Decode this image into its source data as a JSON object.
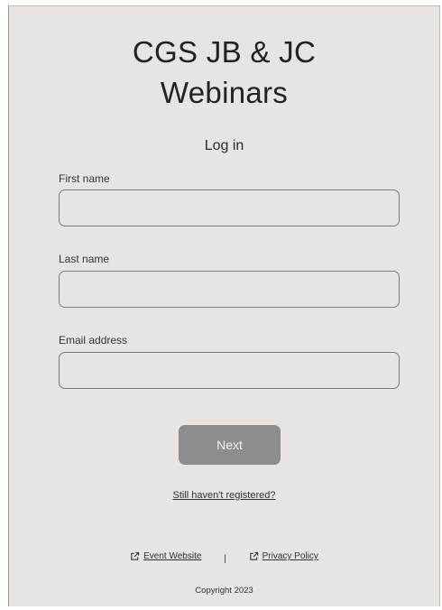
{
  "header": {
    "title_line1": "CGS JB & JC",
    "title_line2": "Webinars",
    "subtitle": "Log in"
  },
  "form": {
    "first_name_label": "First name",
    "first_name_value": "",
    "last_name_label": "Last name",
    "last_name_value": "",
    "email_label": "Email address",
    "email_value": "",
    "next_label": "Next"
  },
  "links": {
    "register": "Still haven't registered?",
    "event_website": "Event Website",
    "separator": "|",
    "privacy_policy": "Privacy Policy"
  },
  "footer": {
    "copyright": "Copyright 2023"
  },
  "icons": {
    "external_link": "external-link-icon"
  },
  "colors": {
    "background": "#e7e4e1",
    "button": "#8d8d8d",
    "input_border": "#7b7b7b"
  }
}
